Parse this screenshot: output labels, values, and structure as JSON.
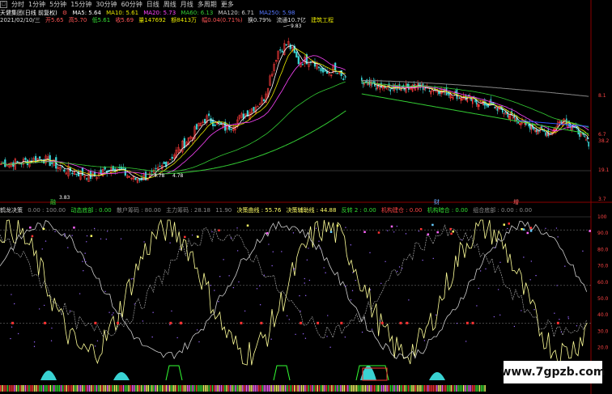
{
  "toolbar": {
    "items": [
      "分时",
      "1分钟",
      "5分钟",
      "15分钟",
      "30分钟",
      "60分钟",
      "日线",
      "周线",
      "月线",
      "多周期",
      "更多"
    ]
  },
  "main_info": {
    "stock": "天健集团(日线 前复权)",
    "ma5": "MA5: 5.64",
    "ma10": "MA10: 5.61",
    "ma20": "MA20: 5.73",
    "ma60": "MA60: 6.13",
    "ma120": "MA120: 6.71",
    "ma250": "MA250: 5.98"
  },
  "detail_info": {
    "date": "2021/02/10/三",
    "open": "开5.65",
    "high": "高5.70",
    "low": "低5.61",
    "close": "收5.69",
    "volume": "量147692",
    "amount": "额8413万",
    "change": "幅0.04(0.71%)",
    "turnover": "换0.79%",
    "float_cap": "流通10.7亿",
    "industry": "建筑工程"
  },
  "price_marks": {
    "high": "9.83",
    "low": "3.83",
    "mid": "4.78",
    "mid_left": "4.78"
  },
  "right_axis_main": [
    "8.1",
    "6.7",
    "38.2",
    "19.1",
    "3.7"
  ],
  "event_marks": [
    "融",
    "财",
    "增"
  ],
  "indicator_info": {
    "name": "鹤龙决策",
    "v1": "0.00 : 100.00",
    "v2": "动态底部 : 0.00",
    "v3": "散户筹码 : 80.00",
    "v4": "主力筹码 : 28.18",
    "v5": "11.90",
    "v6": "决策曲线 : 55.76",
    "v7": "决策辅助线 : 44.88",
    "v8": "反转 2 : 0.00",
    "v9": "机构建仓 : 0.00",
    "v10": "机构暗合 : 0.00",
    "v11": "组合底部 : 0.00 : 0.00"
  },
  "right_axis_ind": [
    "100",
    "90.0",
    "80.0",
    "70.0",
    "60.0",
    "50.0",
    "40.0",
    "30.0",
    "20.0"
  ],
  "watermark": "www.7gpzb.com",
  "colors": {
    "up": "#ff3b3b",
    "down": "#39d2d2",
    "ma5": "#ffffff",
    "ma10": "#e6e600",
    "ma20": "#ff44ff",
    "ma60": "#33cc33",
    "ma250": "#888888"
  },
  "chart_data": {
    "type": "line",
    "series": [
      {
        "name": "MA5",
        "values": [
          5.0,
          5.1,
          4.9,
          4.7,
          4.6,
          4.7,
          4.8,
          5.6,
          6.5,
          6.7,
          6.4,
          6.8,
          8.3,
          9.5,
          8.9,
          8.7,
          8.2,
          7.9,
          7.6,
          7.4,
          7.0,
          6.6,
          6.3,
          6.1,
          5.9,
          5.7,
          5.6,
          5.65
        ]
      },
      {
        "name": "MA10",
        "values": [
          5.0,
          5.05,
          4.95,
          4.8,
          4.65,
          4.65,
          4.75,
          5.2,
          6.0,
          6.5,
          6.5,
          6.6,
          7.5,
          8.7,
          8.9,
          8.6,
          8.3,
          8.0,
          7.8,
          7.5,
          7.1,
          6.8,
          6.5,
          6.2,
          6.0,
          5.8,
          5.65,
          5.61
        ]
      },
      {
        "name": "MA20",
        "values": [
          4.9,
          5.0,
          5.0,
          4.9,
          4.8,
          4.7,
          4.7,
          4.9,
          5.4,
          5.9,
          6.2,
          6.4,
          6.8,
          7.6,
          8.2,
          8.3,
          8.2,
          8.0,
          7.9,
          7.7,
          7.4,
          7.1,
          6.8,
          6.5,
          6.2,
          6.0,
          5.85,
          5.73
        ]
      },
      {
        "name": "MA60",
        "values": [
          4.7,
          4.75,
          4.8,
          4.8,
          4.8,
          4.75,
          4.72,
          4.75,
          4.85,
          5.0,
          5.2,
          5.4,
          5.6,
          6.0,
          6.5,
          6.9,
          7.2,
          7.4,
          7.5,
          7.5,
          7.4,
          7.2,
          6.9,
          6.7,
          6.5,
          6.35,
          6.2,
          6.13
        ]
      }
    ],
    "ylabel": "",
    "xlabel": ""
  }
}
